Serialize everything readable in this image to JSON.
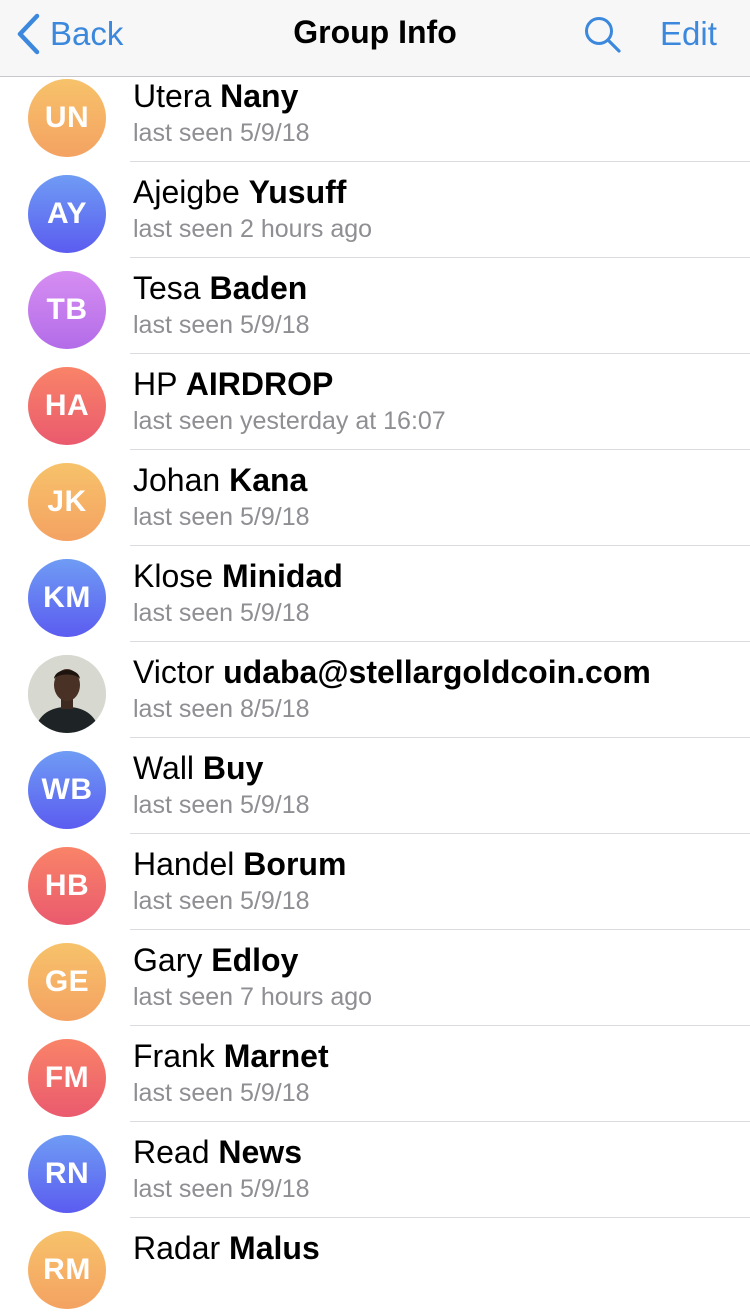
{
  "navbar": {
    "back_label": "Back",
    "title": "Group Info",
    "edit_label": "Edit",
    "search_icon": "search-icon",
    "back_icon": "chevron-left-icon",
    "accent_color": "#3b88dd"
  },
  "members": [
    {
      "initials": "UN",
      "first": "Utera",
      "last": "Nany",
      "status": "last seen 5/9/18",
      "color": "orange"
    },
    {
      "initials": "AY",
      "first": "Ajeigbe",
      "last": "Yusuff",
      "status": "last seen 2 hours ago",
      "color": "blue"
    },
    {
      "initials": "TB",
      "first": "Tesa",
      "last": "Baden",
      "status": "last seen 5/9/18",
      "color": "violet"
    },
    {
      "initials": "HA",
      "first": "HP",
      "last": "AIRDROP",
      "status": "last seen yesterday at 16:07",
      "color": "red"
    },
    {
      "initials": "JK",
      "first": "Johan",
      "last": "Kana",
      "status": "last seen 5/9/18",
      "color": "orange"
    },
    {
      "initials": "KM",
      "first": "Klose",
      "last": "Minidad",
      "status": "last seen 5/9/18",
      "color": "blue"
    },
    {
      "initials": "",
      "first": "Victor",
      "last": "udaba@stellargoldcoin.com",
      "status": "last seen 8/5/18",
      "color": "photo"
    },
    {
      "initials": "WB",
      "first": "Wall",
      "last": "Buy",
      "status": "last seen 5/9/18",
      "color": "blue"
    },
    {
      "initials": "HB",
      "first": "Handel",
      "last": "Borum",
      "status": "last seen 5/9/18",
      "color": "red"
    },
    {
      "initials": "GE",
      "first": "Gary",
      "last": "Edloy",
      "status": "last seen 7 hours ago",
      "color": "orange"
    },
    {
      "initials": "FM",
      "first": "Frank",
      "last": "Marnet",
      "status": "last seen 5/9/18",
      "color": "red"
    },
    {
      "initials": "RN",
      "first": "Read",
      "last": "News",
      "status": "last seen 5/9/18",
      "color": "blue"
    },
    {
      "initials": "RM",
      "first": "Radar",
      "last": "Malus",
      "status": "",
      "color": "orange"
    }
  ]
}
